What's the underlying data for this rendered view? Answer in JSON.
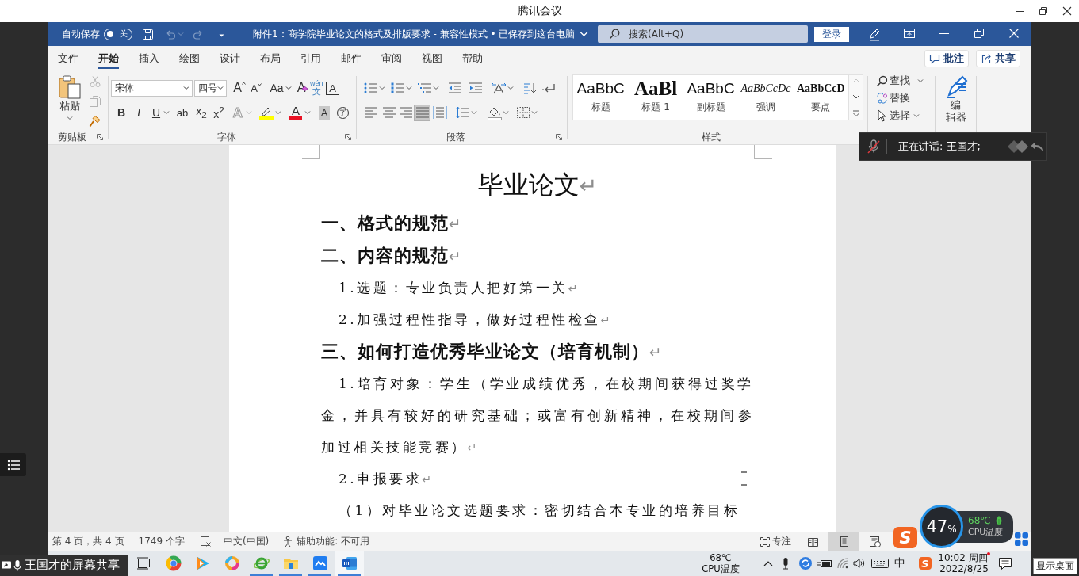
{
  "meeting_bar": {
    "title": "腾讯会议"
  },
  "word": {
    "title_bar": {
      "autosave_label": "自动保存",
      "autosave": {
        "on": false,
        "label": "关"
      },
      "undo": {
        "disabled": true
      },
      "redo": {
        "disabled": true
      },
      "document_title": "附件1：商学院毕业论文的格式及排版要求 - 兼容性模式 • 已保存到这台电脑",
      "search": {
        "placeholder": "搜索(Alt+Q)"
      },
      "sign_in": "登录"
    },
    "tabs": [
      {
        "label": "文件",
        "selected": false
      },
      {
        "label": "开始",
        "selected": true
      },
      {
        "label": "插入",
        "selected": false
      },
      {
        "label": "绘图",
        "selected": false
      },
      {
        "label": "设计",
        "selected": false
      },
      {
        "label": "布局",
        "selected": false
      },
      {
        "label": "引用",
        "selected": false
      },
      {
        "label": "邮件",
        "selected": false
      },
      {
        "label": "审阅",
        "selected": false
      },
      {
        "label": "视图",
        "selected": false
      },
      {
        "label": "帮助",
        "selected": false
      }
    ],
    "comments_button": "批注",
    "share_button": "共享",
    "ribbon": {
      "clipboard": {
        "paste": "粘贴",
        "cut": {
          "disabled": true
        },
        "copy": {
          "disabled": true
        },
        "group": "剪贴板"
      },
      "font": {
        "face": "宋体",
        "size": "四号",
        "grow": "A",
        "shrink": "A",
        "change_case": "Aa",
        "clear_format": "A",
        "phonetic": "wén",
        "phonetic_char": "文",
        "char_border": "A",
        "bold": "B",
        "italic": "I",
        "underline": "U",
        "strikethrough": "ab",
        "subscript": "x$_{2}$",
        "superscript": "x$^{2}$",
        "effects": "A",
        "font_color": "A",
        "char_shading": "A",
        "enclose": "字",
        "group": "字体"
      },
      "paragraph": {
        "alignment": [
          {
            "selected": false
          },
          {
            "selected": false
          },
          {
            "selected": false
          },
          {
            "selected": true
          },
          {
            "selected": false
          }
        ],
        "group": "段落"
      },
      "styles": {
        "items": [
          {
            "preview": "AaBbC",
            "name": "标题",
            "kind": "title"
          },
          {
            "preview": "AaBl",
            "name": "标题 1",
            "kind": "heading"
          },
          {
            "preview": "AaBbC",
            "name": "副标题",
            "kind": "subtitle"
          },
          {
            "preview": "AaBbCcDc",
            "name": "强调",
            "kind": "emphasis"
          },
          {
            "preview": "AaBbCcD",
            "name": "要点",
            "kind": "strong"
          }
        ],
        "scroll_up": {
          "disabled": true
        },
        "group": "样式"
      },
      "editing": {
        "find": "查找",
        "replace": "替换",
        "select": "选择"
      },
      "editor": {
        "lines": [
          "编",
          "辑器"
        ]
      }
    },
    "document": {
      "paragraphs": [
        {
          "kind": "title",
          "text": "毕业论文",
          "mark": "↵"
        },
        {
          "kind": "heading",
          "text": "一、格式的规范",
          "mark": "↵"
        },
        {
          "kind": "heading",
          "text": "二、内容的规范",
          "mark": "↵"
        },
        {
          "kind": "item",
          "text": "1.选题：专业负责人把好第一关",
          "mark": "↵"
        },
        {
          "kind": "item",
          "text": "2.加强过程性指导，做好过程性检查",
          "mark": "↵"
        },
        {
          "kind": "heading",
          "text": "三、如何打造优秀毕业论文（培育机制）",
          "mark": "↵"
        },
        {
          "kind": "body",
          "text": "1.培育对象：学生（学业成绩优秀，在校期间获得过奖学金，并具有较好的研究基础；或富有创新精神，在校期间参加过相关技能竞赛）",
          "mark": "↵"
        },
        {
          "kind": "item",
          "text": "2.申报要求",
          "mark": "↵"
        },
        {
          "kind": "body",
          "text": "（1）对毕业论文选题要求：密切结合本专业的培养目标"
        }
      ]
    },
    "status_bar": {
      "page": "第 4 页，共 4 页",
      "words": "1749 个字",
      "language": "中文(中国)",
      "accessibility": "辅助功能: 不可用",
      "focus": "专注",
      "views": [
        {
          "selected": false
        },
        {
          "selected": true
        },
        {
          "selected": false
        }
      ]
    }
  },
  "taskbar": {
    "apps": [
      {
        "running": false,
        "active": false
      },
      {
        "running": false,
        "active": false
      },
      {
        "running": false,
        "active": false
      },
      {
        "running": true,
        "active": false
      },
      {
        "running": true,
        "active": false
      },
      {
        "running": true,
        "active": false
      },
      {
        "running": true,
        "active": true
      }
    ],
    "cpu_temperature": "68℃",
    "cpu_label": "CPU温度",
    "ime_mode": "中",
    "ime_logo": "S",
    "time": "10:02 周四",
    "date": "2022/8/25"
  },
  "overlays": {
    "screen_share": "王国才的屏幕共享",
    "speaking": {
      "muted": true,
      "text": "正在讲话: 王国才;"
    },
    "cpu_widget": {
      "usage": "47",
      "unit": "%",
      "temperature": "68℃",
      "label": "CPU温度"
    },
    "ime_logo": "S",
    "show_desktop_tip": "显示桌面"
  }
}
